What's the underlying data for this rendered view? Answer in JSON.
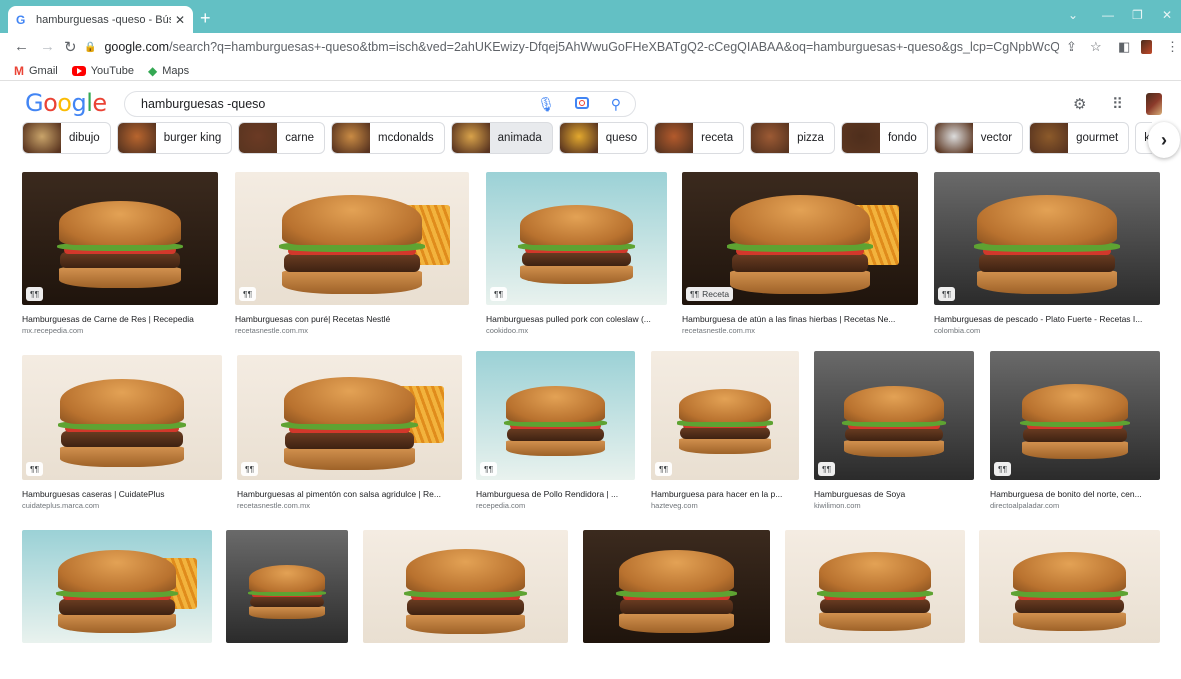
{
  "browser": {
    "tab_title": "hamburguesas -queso - Búsqued",
    "url_host": "google.com",
    "url_rest": "/search?q=hamburguesas+-queso&tbm=isch&ved=2ahUKEwizy-Dfqej5AhWwuGoFHeXBATgQ2-cCegQIABAA&oq=hamburguesas+-queso&gs_lcp=CgNpbWcQAzoECCMQJzoECAAQHjoGCAAQ...",
    "bookmarks": [
      "Gmail",
      "YouTube",
      "Maps"
    ]
  },
  "search": {
    "logo": [
      "G",
      "o",
      "o",
      "g",
      "l",
      "e"
    ],
    "query": "hamburguesas -queso"
  },
  "chips": [
    {
      "label": "dibujo",
      "color": "#c9a46a"
    },
    {
      "label": "burger king",
      "color": "#b8652e"
    },
    {
      "label": "carne",
      "color": "#6b3a24"
    },
    {
      "label": "mcdonalds",
      "color": "#c98b44"
    },
    {
      "label": "animada",
      "color": "#d8a24a",
      "active": true
    },
    {
      "label": "queso",
      "color": "#e2a82e"
    },
    {
      "label": "receta",
      "color": "#b35a2c"
    },
    {
      "label": "pizza",
      "color": "#9c5a34"
    },
    {
      "label": "fondo",
      "color": "#4e2e1c"
    },
    {
      "label": "vector",
      "color": "#dcdcdc"
    },
    {
      "label": "gourmet",
      "color": "#8c5a2a"
    },
    {
      "label": "kawaii",
      "color": "#ffffff"
    }
  ],
  "images": [
    {
      "title": "Hamburguesas de Carne de Res | Recepedia",
      "source": "mx.recepedia.com",
      "badge": ""
    },
    {
      "title": "Hamburguesas con puré| Recetas Nestlé",
      "source": "recetasnestle.com.mx",
      "badge": ""
    },
    {
      "title": "Hamburguesas pulled pork con coleslaw (...",
      "source": "cookidoo.mx",
      "badge": ""
    },
    {
      "title": "Hamburguesa de atún a las finas hierbas | Recetas Ne...",
      "source": "recetasnestle.com.mx",
      "badge": "Receta"
    },
    {
      "title": "Hamburguesas de pescado - Plato Fuerte - Recetas I...",
      "source": "colombia.com",
      "badge": ""
    },
    {
      "title": "Hamburguesas caseras | CuidatePlus",
      "source": "cuidateplus.marca.com",
      "badge": ""
    },
    {
      "title": "Hamburguesas al pimentón con salsa agridulce | Re...",
      "source": "recetasnestle.com.mx",
      "badge": ""
    },
    {
      "title": "Hamburguesa de Pollo Rendidora | ...",
      "source": "recepedia.com",
      "badge": ""
    },
    {
      "title": "Hamburguesa para hacer en la p...",
      "source": "hazteveg.com",
      "badge": ""
    },
    {
      "title": "Hamburguesas de Soya",
      "source": "kiwilimon.com",
      "badge": ""
    },
    {
      "title": "Hamburguesa de bonito del norte, cen...",
      "source": "directoalpaladar.com",
      "badge": ""
    },
    {
      "title": "",
      "source": "",
      "badge": ""
    },
    {
      "title": "",
      "source": "",
      "badge": ""
    },
    {
      "title": "",
      "source": "",
      "badge": ""
    },
    {
      "title": "",
      "source": "",
      "badge": ""
    },
    {
      "title": "",
      "source": "",
      "badge": ""
    },
    {
      "title": "",
      "source": "",
      "badge": ""
    }
  ],
  "colors": {
    "accent": "#4285f4",
    "tabstrip": "#63c0c4"
  }
}
